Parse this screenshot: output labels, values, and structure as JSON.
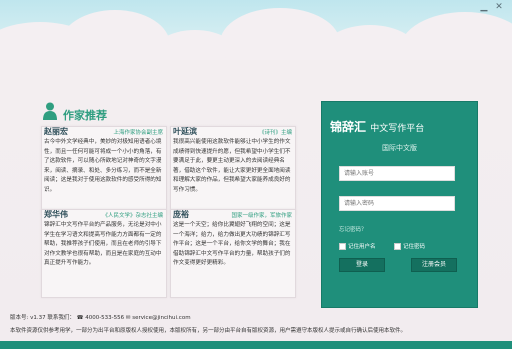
{
  "window": {
    "minimize": "▁",
    "close": "✕"
  },
  "section": {
    "title": "作家推荐"
  },
  "cards": [
    {
      "name": "赵丽宏",
      "tag": "上海作家协会副主席",
      "body": "古今中外文学经典中，美妙的对极知用语者心境性，而且一任何可能可将成一个小小的角落，有了这款软件，可以随心所欲地记对神奇的文字漫来，阅读、摘录、和处、多分练习，而不是全新阅读；这是我对于使用这款软件的感受所得的知识。"
    },
    {
      "name": "叶延滨",
      "tag": "《诗刊》主编",
      "body": "我很高兴能使用这款软件能够让中小学生的作文成绩得到快速提升的愿，但我希望中小学生们不要满足于此，要更主动更深入的去阅读经典名著，借助这个软件，能让大家更好更全面地阅读和理解大家的作品，但我希望大家能养成良好的写作习惯。"
    },
    {
      "name": "郑华伟",
      "tag": "《人民文学》杂志社主编",
      "body": "锦辞汇中文写作平台的产品服务，无论是对中小学生在学习语文和提高写作能力方面都有一定的帮助，我推荐孩子们使用，而且在老师的引导下对作文教学也很有帮助，而且是在家庭的互动中真正提升写作能力。"
    },
    {
      "name": "庞裕",
      "tag": "国家一级作家，军旅作家",
      "body": "这是一个天空；给你比翼翅好飞翔的空间；这是一个海洋；给力，给力做出更大功绩的锦辞汇写作平台；这是一个平台，给你文学的舞台；我在借助锦辞汇中文写作平台的力量，帮助孩子们的作文变得更好更精彩。"
    }
  ],
  "login": {
    "logo_main": "锦辞汇",
    "logo_sub": "中文写作平台",
    "version": "国际中文版",
    "username_placeholder": "请输入账号",
    "password_placeholder": "请输入密码",
    "forgot": "忘记密码？",
    "remember_user": "记住用户名",
    "remember_password": "记住密码",
    "login_button": "登录",
    "register_button": "注册会员"
  },
  "footer": {
    "line1": "版本号: v1.37   联系我们： ☎ 4000-533-556   ✉ service@jincihui.com",
    "line2": "本软件资源仅供参考用学，一部分为出平台和原版权人授权使用，本版权所有，另一部分由平台自有版权资源，用户需遵守本版权人提示或自行确认后使用本软件。"
  }
}
